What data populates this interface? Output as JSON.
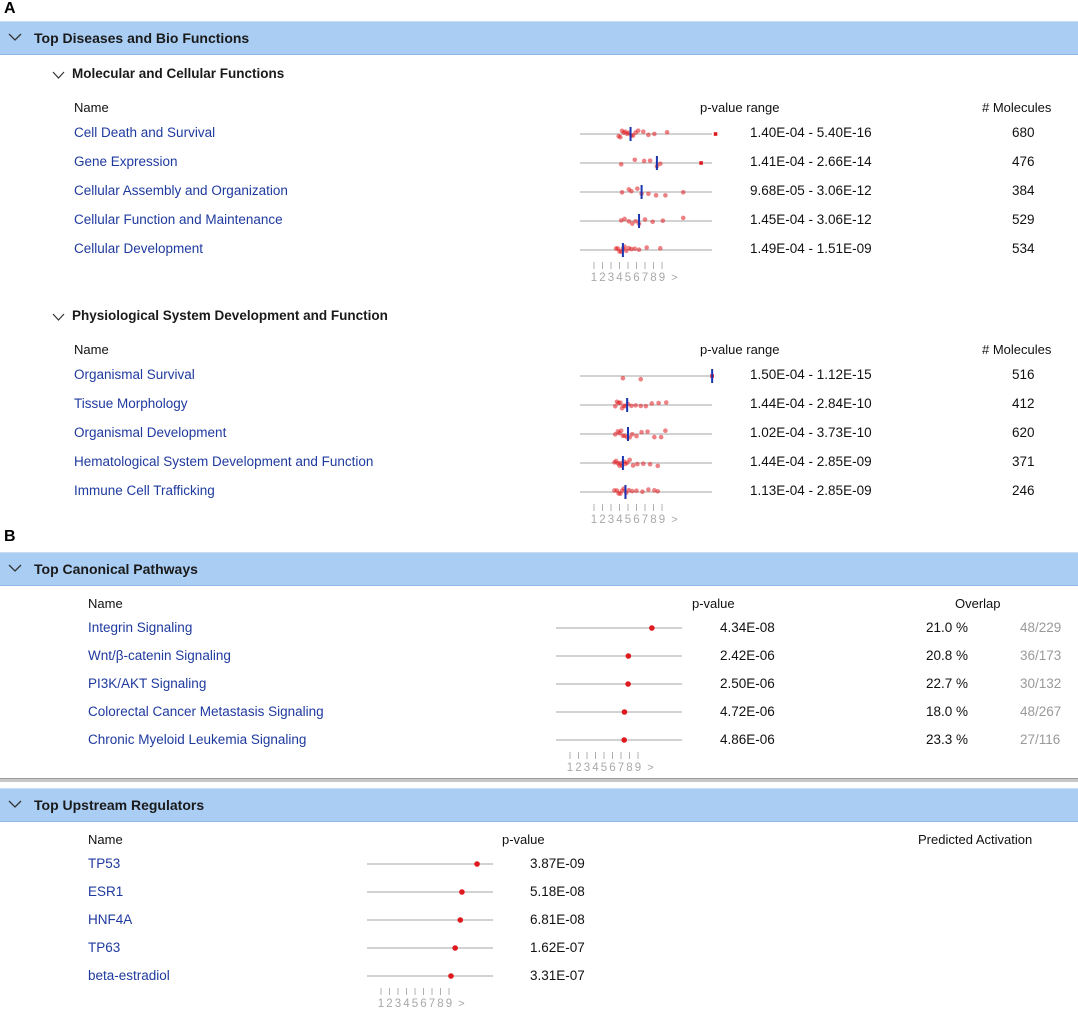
{
  "panels": {
    "a": "A",
    "b": "B"
  },
  "diseases": {
    "title": "Top Diseases and Bio Functions",
    "groups": [
      {
        "title": "Molecular and Cellular Functions",
        "col_name": "Name",
        "col_range": "p-value range",
        "col_mol": "# Molecules",
        "rows": [
          {
            "name": "Cell Death and Survival",
            "range": "1.40E-04 - 5.40E-16",
            "mol": "680"
          },
          {
            "name": "Gene Expression",
            "range": "1.41E-04 - 2.66E-14",
            "mol": "476"
          },
          {
            "name": "Cellular Assembly and Organization",
            "range": "9.68E-05 - 3.06E-12",
            "mol": "384"
          },
          {
            "name": "Cellular Function and Maintenance",
            "range": "1.45E-04 - 3.06E-12",
            "mol": "529"
          },
          {
            "name": "Cellular Development",
            "range": "1.49E-04 - 1.51E-09",
            "mol": "534"
          }
        ]
      },
      {
        "title": "Physiological System Development and Function",
        "col_name": "Name",
        "col_range": "p-value range",
        "col_mol": "# Molecules",
        "rows": [
          {
            "name": "Organismal Survival",
            "range": "1.50E-04 - 1.12E-15",
            "mol": "516"
          },
          {
            "name": "Tissue Morphology",
            "range": "1.44E-04 - 2.84E-10",
            "mol": "412"
          },
          {
            "name": "Organismal Development",
            "range": "1.02E-04 - 3.73E-10",
            "mol": "620"
          },
          {
            "name": "Hematological System Development and Function",
            "range": "1.44E-04 - 2.85E-09",
            "mol": "371"
          },
          {
            "name": "Immune Cell Trafficking",
            "range": "1.13E-04 - 2.85E-09",
            "mol": "246"
          }
        ]
      }
    ]
  },
  "pathways": {
    "title": "Top Canonical Pathways",
    "col_name": "Name",
    "col_p": "p-value",
    "col_overlap": "Overlap",
    "rows": [
      {
        "name": "Integrin Signaling",
        "p": "4.34E-08",
        "pct": "21.0 %",
        "ratio": "48/229"
      },
      {
        "name": "Wnt/β-catenin Signaling",
        "p": "2.42E-06",
        "pct": "20.8 %",
        "ratio": "36/173"
      },
      {
        "name": "PI3K/AKT Signaling",
        "p": "2.50E-06",
        "pct": "22.7 %",
        "ratio": "30/132"
      },
      {
        "name": "Colorectal Cancer Metastasis Signaling",
        "p": "4.72E-06",
        "pct": "18.0 %",
        "ratio": "48/267"
      },
      {
        "name": "Chronic Myeloid Leukemia Signaling",
        "p": "4.86E-06",
        "pct": "23.3 %",
        "ratio": "27/116"
      }
    ]
  },
  "regulators": {
    "title": "Top Upstream Regulators",
    "col_name": "Name",
    "col_p": "p-value",
    "col_act": "Predicted Activation",
    "rows": [
      {
        "name": "TP53",
        "p": "3.87E-09"
      },
      {
        "name": "ESR1",
        "p": "5.18E-08"
      },
      {
        "name": "HNF4A",
        "p": "6.81E-08"
      },
      {
        "name": "TP63",
        "p": "1.62E-07"
      },
      {
        "name": "beta-estradiol",
        "p": "3.31E-07"
      }
    ]
  },
  "axis": {
    "ticks": [
      "1",
      "2",
      "3",
      "4",
      "5",
      "6",
      "7",
      "8",
      "9"
    ],
    "more": ">"
  },
  "chart_data": {
    "type": "scatter",
    "description_units": "-log10(p-value)",
    "x_ticks": [
      "1",
      "2",
      "3",
      "4",
      "5",
      "6",
      "7",
      "8",
      "9"
    ],
    "diseases": [
      {
        "name": "Cell Death and Survival",
        "median": 5.3,
        "max": 15.3,
        "points": [
          3.9,
          4.1,
          4.3,
          4.5,
          4.7,
          4.9,
          5.1,
          5.4,
          5.6,
          5.9,
          6.2,
          6.8,
          7.4,
          8.1,
          9.6,
          15.3
        ]
      },
      {
        "name": "Gene Expression",
        "median": 8.4,
        "max": 13.6,
        "points": [
          4.2,
          5.8,
          6.9,
          7.6,
          8.4,
          8.8,
          13.6
        ]
      },
      {
        "name": "Cellular Assembly and Organization",
        "median": 6.6,
        "max": 11.5,
        "points": [
          4.3,
          5.1,
          5.4,
          6.1,
          6.6,
          7.4,
          8.3,
          9.4,
          11.5
        ]
      },
      {
        "name": "Cellular Function and Maintenance",
        "median": 6.3,
        "max": 11.5,
        "points": [
          4.2,
          4.6,
          5.1,
          5.5,
          5.9,
          6.3,
          7.0,
          7.9,
          9.1,
          11.5
        ]
      },
      {
        "name": "Cellular Development",
        "median": 4.4,
        "max": 8.8,
        "points": [
          3.6,
          3.8,
          4.0,
          4.2,
          4.4,
          4.6,
          4.8,
          5.1,
          5.4,
          5.8,
          6.3,
          7.2,
          8.8
        ]
      },
      {
        "name": "Organismal Survival",
        "median": 14.9,
        "max": 14.9,
        "points": [
          4.4,
          6.5,
          14.9
        ]
      },
      {
        "name": "Tissue Morphology",
        "median": 4.9,
        "max": 9.5,
        "points": [
          3.5,
          3.7,
          3.9,
          4.1,
          4.3,
          4.5,
          4.7,
          5.0,
          5.4,
          5.9,
          6.5,
          7.1,
          7.8,
          8.6,
          9.5
        ]
      },
      {
        "name": "Organismal Development",
        "median": 5.0,
        "max": 9.4,
        "points": [
          3.5,
          3.8,
          4.0,
          4.2,
          4.4,
          4.6,
          4.9,
          5.2,
          5.5,
          6.0,
          6.6,
          7.3,
          8.1,
          8.9,
          9.4
        ]
      },
      {
        "name": "Hematological System Development and Function",
        "median": 4.4,
        "max": 8.5,
        "points": [
          3.4,
          3.6,
          3.8,
          4.0,
          4.1,
          4.3,
          4.5,
          4.7,
          4.9,
          5.2,
          5.6,
          6.1,
          6.8,
          7.6,
          8.5
        ]
      },
      {
        "name": "Immune Cell Trafficking",
        "median": 4.7,
        "max": 8.5,
        "points": [
          3.4,
          3.7,
          3.9,
          4.1,
          4.3,
          4.5,
          4.8,
          5.1,
          5.5,
          6.0,
          6.7,
          7.4,
          8.1,
          8.5
        ]
      }
    ],
    "pathways": [
      {
        "name": "Integrin Signaling",
        "value": 7.36
      },
      {
        "name": "Wnt/β-catenin Signaling",
        "value": 5.62
      },
      {
        "name": "PI3K/AKT Signaling",
        "value": 5.6
      },
      {
        "name": "Colorectal Cancer Metastasis Signaling",
        "value": 5.33
      },
      {
        "name": "Chronic Myeloid Leukemia Signaling",
        "value": 5.31
      }
    ],
    "regulators": [
      {
        "name": "TP53",
        "value": 8.41
      },
      {
        "name": "ESR1",
        "value": 7.29
      },
      {
        "name": "HNF4A",
        "value": 7.17
      },
      {
        "name": "TP63",
        "value": 6.79
      },
      {
        "name": "beta-estradiol",
        "value": 6.48
      }
    ]
  },
  "colors": {
    "header_bg": "#a9cdf3",
    "link": "#1f3a9f",
    "dot": "#e0191f",
    "median": "#1a33b0",
    "line": "#a6a6a6"
  }
}
